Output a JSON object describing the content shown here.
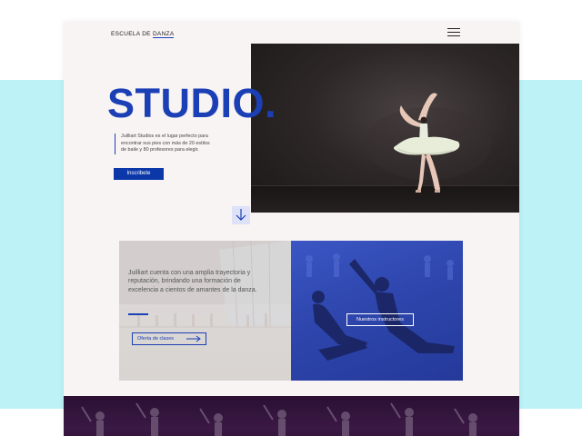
{
  "header": {
    "brand_prefix": "ESCUELA DE ",
    "brand_accent": "DANZA",
    "menu_icon": "hamburger-menu-icon"
  },
  "hero": {
    "title": "STUDIO",
    "title_dot": ".",
    "description": "Juilliart Studios es el lugar perfecto para encontrar sus pies con más de 20 estilos de baile y 80 profesores para elegir.",
    "cta_label": "Inscribete",
    "scroll_icon": "arrow-down-icon",
    "photo": "ballerina-on-stage-photo"
  },
  "about": {
    "text": "Juilliart cuenta con una amplia trayectoria y reputación, brindando una formación de excelencia a cientos de amantes de la danza.",
    "classes_button": "Oferta de clases",
    "classes_icon": "arrow-right-icon",
    "instructors_button": "Nuestros instructores",
    "carousel_dots": 3
  },
  "colors": {
    "accent": "#1b3fb5",
    "cta_bg": "#0b37a8",
    "band": "#bdf2f7",
    "page_bg": "#f9f4f4",
    "overlay_blue": "#2e46ad",
    "footer_purple": "#3a1945"
  }
}
